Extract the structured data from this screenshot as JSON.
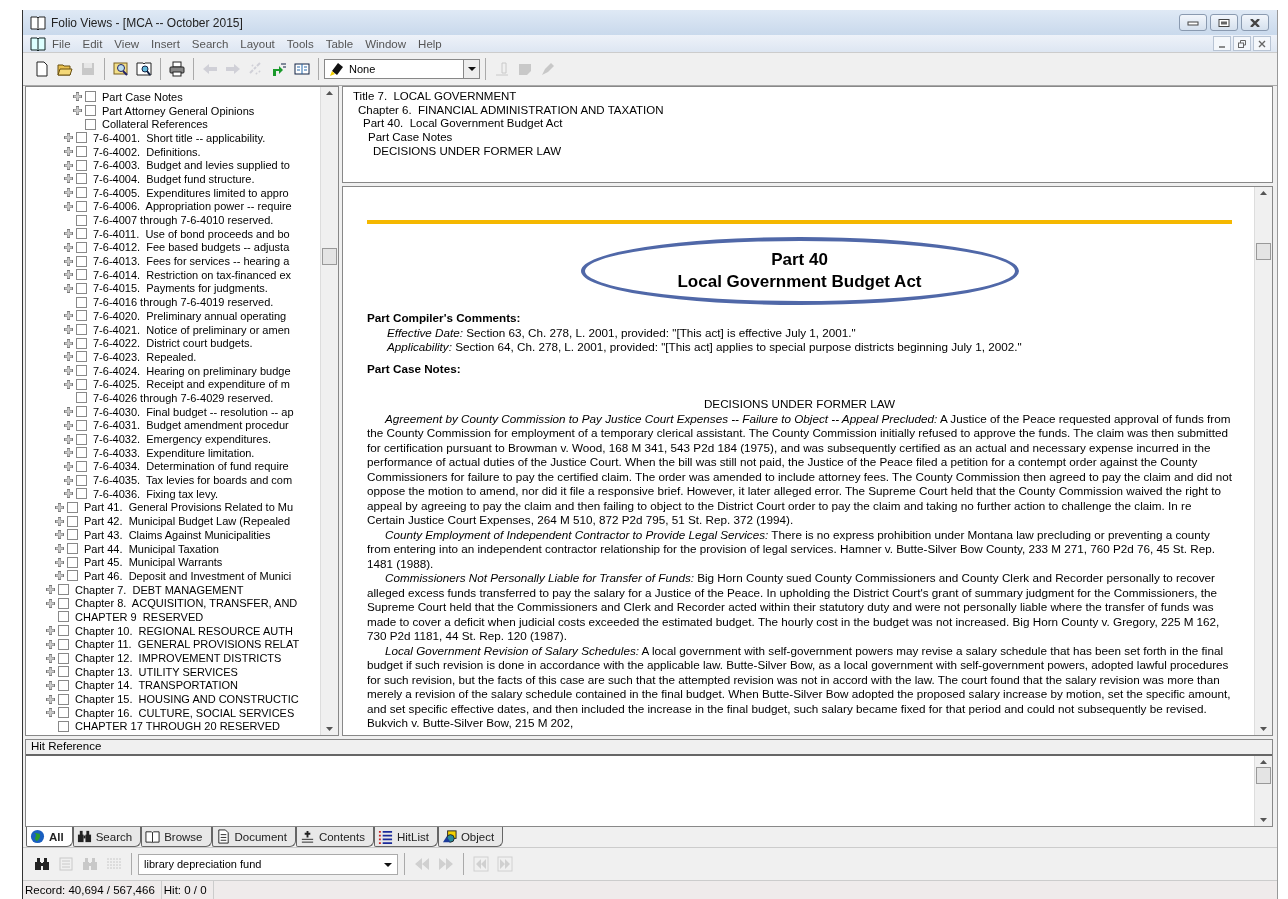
{
  "window": {
    "title": "Folio Views - [MCA -- October 2015]"
  },
  "menu": [
    "File",
    "Edit",
    "View",
    "Insert",
    "Search",
    "Layout",
    "Tools",
    "Table",
    "Window",
    "Help"
  ],
  "toolbar": {
    "buttons": [
      {
        "kind": "new",
        "disabled": false
      },
      {
        "kind": "open",
        "disabled": false
      },
      {
        "kind": "save",
        "disabled": true
      },
      {
        "kind": "sep"
      },
      {
        "kind": "find",
        "disabled": false
      },
      {
        "kind": "book-find",
        "disabled": false
      },
      {
        "kind": "sep"
      },
      {
        "kind": "print",
        "disabled": false
      },
      {
        "kind": "sep"
      },
      {
        "kind": "back",
        "disabled": true
      },
      {
        "kind": "forward",
        "disabled": true
      },
      {
        "kind": "sparkle",
        "disabled": true
      },
      {
        "kind": "jump",
        "disabled": false
      },
      {
        "kind": "split",
        "disabled": false
      }
    ],
    "style_value": "None",
    "tail_buttons": [
      {
        "kind": "pin",
        "disabled": true
      },
      {
        "kind": "note",
        "disabled": true
      },
      {
        "kind": "marker",
        "disabled": true
      }
    ]
  },
  "tree": [
    {
      "children": [
        {
          "children": [
            {
              "children": [
                {
                  "label": "Part Case Notes",
                  "expandable": true,
                  "checked": false
                },
                {
                  "label": "Part Attorney General Opinions",
                  "expandable": true,
                  "checked": false
                },
                {
                  "label": "Collateral References",
                  "expandable": false,
                  "checked": false
                }
              ]
            },
            {
              "label": "7-6-4001.  Short title -- applicability.",
              "expandable": true,
              "checked": false
            },
            {
              "label": "7-6-4002.  Definitions.",
              "expandable": true,
              "checked": false
            },
            {
              "label": "7-6-4003.  Budget and levies supplied to",
              "expandable": true,
              "checked": false
            },
            {
              "label": "7-6-4004.  Budget fund structure.",
              "expandable": true,
              "checked": false
            },
            {
              "label": "7-6-4005.  Expenditures limited to appro",
              "expandable": true,
              "checked": false
            },
            {
              "label": "7-6-4006.  Appropriation power -- require",
              "expandable": true,
              "checked": false
            },
            {
              "label": "7-6-4007 through 7-6-4010 reserved.",
              "expandable": false,
              "checked": false
            },
            {
              "label": "7-6-4011.  Use of bond proceeds and bo",
              "expandable": true,
              "checked": false
            },
            {
              "label": "7-6-4012.  Fee based budgets -- adjusta",
              "expandable": true,
              "checked": false
            },
            {
              "label": "7-6-4013.  Fees for services -- hearing a",
              "expandable": true,
              "checked": false
            },
            {
              "label": "7-6-4014.  Restriction on tax-financed ex",
              "expandable": true,
              "checked": false
            },
            {
              "label": "7-6-4015.  Payments for judgments.",
              "expandable": true,
              "checked": false
            },
            {
              "label": "7-6-4016 through 7-6-4019 reserved.",
              "expandable": false,
              "checked": false
            },
            {
              "label": "7-6-4020.  Preliminary annual operating",
              "expandable": true,
              "checked": false
            },
            {
              "label": "7-6-4021.  Notice of preliminary or amen",
              "expandable": true,
              "checked": false
            },
            {
              "label": "7-6-4022.  District court budgets.",
              "expandable": true,
              "checked": false
            },
            {
              "label": "7-6-4023.  Repealed.",
              "expandable": true,
              "checked": false
            },
            {
              "label": "7-6-4024.  Hearing on preliminary budge",
              "expandable": true,
              "checked": false
            },
            {
              "label": "7-6-4025.  Receipt and expenditure of m",
              "expandable": true,
              "checked": false
            },
            {
              "label": "7-6-4026 through 7-6-4029 reserved.",
              "expandable": false,
              "checked": false
            },
            {
              "label": "7-6-4030.  Final budget -- resolution -- ap",
              "expandable": true,
              "checked": false
            },
            {
              "label": "7-6-4031.  Budget amendment procedur",
              "expandable": true,
              "checked": false
            },
            {
              "label": "7-6-4032.  Emergency expenditures.",
              "expandable": true,
              "checked": false
            },
            {
              "label": "7-6-4033.  Expenditure limitation.",
              "expandable": true,
              "checked": false
            },
            {
              "label": "7-6-4034.  Determination of fund require",
              "expandable": true,
              "checked": false
            },
            {
              "label": "7-6-4035.  Tax levies for boards and com",
              "expandable": true,
              "checked": false
            },
            {
              "label": "7-6-4036.  Fixing tax levy.",
              "expandable": true,
              "checked": false
            }
          ]
        },
        {
          "label": "Part 41.  General Provisions Related to Mu",
          "expandable": true,
          "checked": false
        },
        {
          "label": "Part 42.  Municipal Budget Law (Repealed",
          "expandable": true,
          "checked": false
        },
        {
          "label": "Part 43.  Claims Against Municipalities",
          "expandable": true,
          "checked": false
        },
        {
          "label": "Part 44.  Municipal Taxation",
          "expandable": true,
          "checked": false
        },
        {
          "label": "Part 45.  Municipal Warrants",
          "expandable": true,
          "checked": false
        },
        {
          "label": "Part 46.  Deposit and Investment of Munici",
          "expandable": true,
          "checked": false
        }
      ]
    },
    {
      "label": "Chapter 7.  DEBT MANAGEMENT",
      "expandable": true,
      "checked": false
    },
    {
      "label": "Chapter 8.  ACQUISITION, TRANSFER, AND",
      "expandable": true,
      "checked": false
    },
    {
      "label": "CHAPTER 9  RESERVED",
      "expandable": false,
      "checked": false
    },
    {
      "label": "Chapter 10.  REGIONAL RESOURCE AUTH",
      "expandable": true,
      "checked": false
    },
    {
      "label": "Chapter 11.  GENERAL PROVISIONS RELAT",
      "expandable": true,
      "checked": false
    },
    {
      "label": "Chapter 12.  IMPROVEMENT DISTRICTS",
      "expandable": true,
      "checked": false
    },
    {
      "label": "Chapter 13.  UTILITY SERVICES",
      "expandable": true,
      "checked": false
    },
    {
      "label": "Chapter 14.  TRANSPORTATION",
      "expandable": true,
      "checked": false
    },
    {
      "label": "Chapter 15.  HOUSING AND CONSTRUCTIC",
      "expandable": true,
      "checked": false
    },
    {
      "label": "Chapter 16.  CULTURE, SOCIAL SERVICES",
      "expandable": true,
      "checked": false
    },
    {
      "label": "CHAPTER 17 THROUGH 20 RESERVED",
      "expandable": false,
      "checked": false
    }
  ],
  "breadcrumbs": [
    "Title 7.  LOCAL GOVERNMENT",
    "Chapter 6.  FINANCIAL ADMINISTRATION AND TAXATION",
    "Part 40.  Local Government Budget Act",
    "Part Case Notes",
    "DECISIONS UNDER FORMER LAW"
  ],
  "document": {
    "heading": [
      "Part 40",
      "Local Government Budget Act"
    ],
    "blocks": [
      {
        "kind": "heading",
        "text": "Part Compiler's Comments:"
      },
      {
        "kind": "note",
        "text": "*Effective Date:*   Section 63, Ch. 278, L. 2001, provided: \"[This act] is effective July 1, 2001.\""
      },
      {
        "kind": "note",
        "text": "*Applicability:*   Section 64, Ch. 278, L. 2001, provided: \"[This act] applies to special purpose districts beginning July 1, 2002.\""
      },
      {
        "kind": "heading",
        "text": "Part Case Notes:"
      },
      {
        "kind": "center",
        "text": "DECISIONS UNDER FORMER LAW"
      },
      {
        "kind": "para",
        "text": "*Agreement by County Commission to Pay Justice Court Expenses -- Failure to Object -- Appeal Precluded:*   A Justice of the Peace requested approval of funds from the County Commission for employment of a temporary clerical assistant. The County Commission initially refused to approve the funds. The claim was then submitted for certification pursuant to Browman v. Wood, 168 M 341, 543 P2d 184 (1975), and was subsequently certified as an actual and necessary expense incurred in the performance of actual duties of the Justice Court. When the bill was still not paid, the Justice of the Peace filed a petition for a contempt order against the County Commissioners for failure to pay the certified claim. The order was amended to include attorney fees. The County Commission then agreed to pay the claim and did not oppose the motion to amend, nor did it file a responsive brief. However, it later alleged error. The Supreme Court held that the County Commission waived the right to appeal by agreeing to pay the claim and then failing to object to the District Court order to pay the claim and taking no further action to challenge the claim. In re Certain Justice Court Expenses, 264 M 510, 872 P2d 795, 51 St. Rep. 372 (1994)."
      },
      {
        "kind": "para",
        "text": "*County Employment of Independent Contractor to Provide Legal Services:*   There is no express prohibition under Montana law precluding or preventing a county from entering into an independent contractor relationship for the provision of legal services. Hamner v. Butte-Silver Bow County, 233 M 271, 760 P2d 76, 45 St. Rep. 1481 (1988)."
      },
      {
        "kind": "para",
        "text": "*Commissioners Not Personally Liable for Transfer of Funds:*   Big Horn County sued County Commissioners and County Clerk and Recorder personally to recover alleged excess funds transferred to pay the salary for a Justice of the Peace. In upholding the District Court's grant of summary judgment for the Commissioners, the Supreme Court held that the Commissioners and Clerk and Recorder acted within their statutory duty and were not personally liable where the transfer of funds was made to cover a deficit when judicial costs exceeded the estimated budget. The hourly cost in the budget was not increased. Big Horn County v. Gregory, 225 M 162, 730 P2d 1181, 44 St. Rep. 120 (1987)."
      },
      {
        "kind": "para",
        "text": "*Local Government Revision of Salary Schedules:*   A local government with self-government powers may revise a salary schedule that has been set forth in the final budget if such revision is done in accordance with the applicable law. Butte-Silver Bow, as a local government with self-government powers, adopted lawful procedures for such revision, but the facts of this case are such that the attempted revision was not in accord with the law. The court found that the salary revision was more than merely a revision of the salary schedule contained in the final budget. When Butte-Silver Bow adopted the proposed salary increase by motion, set the specific amount, and set specific effective dates, and then included the increase in the final budget, such salary became fixed for that period and could not subsequently be revised. Bukvich v. Butte-Silver Bow, 215 M 202,"
      }
    ]
  },
  "hit_reference": {
    "title": "Hit Reference"
  },
  "tabs": [
    {
      "label": "All",
      "kind": "globe",
      "selected": true
    },
    {
      "label": "Search",
      "kind": "binoculars",
      "selected": false
    },
    {
      "label": "Browse",
      "kind": "book",
      "selected": false
    },
    {
      "label": "Document",
      "kind": "page",
      "selected": false
    },
    {
      "label": "Contents",
      "kind": "contents",
      "selected": false
    },
    {
      "label": "HitList",
      "kind": "list",
      "selected": false
    },
    {
      "label": "Object",
      "kind": "shapes",
      "selected": false
    }
  ],
  "search_bar": {
    "buttons": [
      {
        "kind": "binoculars",
        "disabled": false
      },
      {
        "kind": "list",
        "disabled": true
      },
      {
        "kind": "binoculars",
        "disabled": true
      },
      {
        "kind": "grid",
        "disabled": true
      }
    ],
    "query": "library depreciation fund",
    "nav": [
      {
        "kind": "prev",
        "disabled": true
      },
      {
        "kind": "next",
        "disabled": true
      },
      {
        "kind": "first",
        "disabled": true
      },
      {
        "kind": "last",
        "disabled": true
      }
    ]
  },
  "status": [
    "Record: 40,694 / 567,466",
    "Hit: 0 / 0"
  ]
}
